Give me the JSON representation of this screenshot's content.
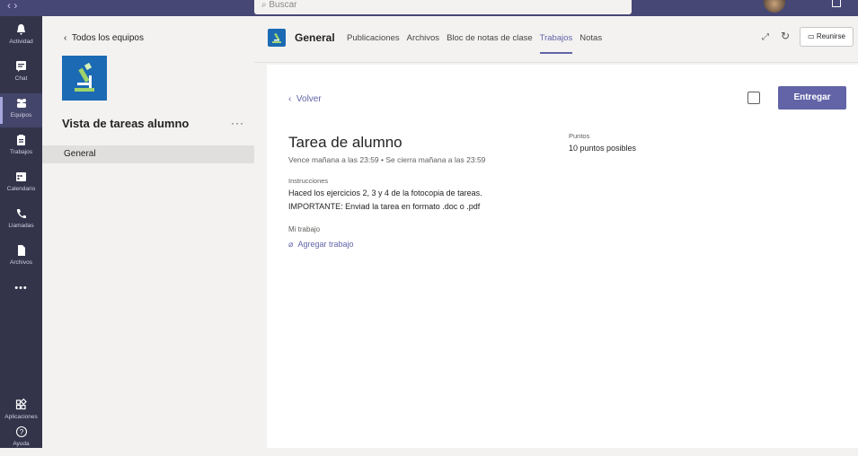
{
  "topbar": {
    "search_placeholder": "Buscar",
    "nav_arrows": "‹  ›"
  },
  "rail": {
    "items": [
      {
        "label": "Actividad",
        "icon": "bell-icon",
        "glyph": "🔔"
      },
      {
        "label": "Chat",
        "icon": "chat-icon",
        "glyph": "▤"
      },
      {
        "label": "Equipos",
        "icon": "teams-icon",
        "glyph": "⁂"
      },
      {
        "label": "Trabajos",
        "icon": "assignments-icon",
        "glyph": "▣"
      },
      {
        "label": "Calendario",
        "icon": "calendar-icon",
        "glyph": "▦"
      },
      {
        "label": "Llamadas",
        "icon": "phone-icon",
        "glyph": "✆"
      },
      {
        "label": "Archivos",
        "icon": "files-icon",
        "glyph": "▮"
      },
      {
        "label": "",
        "icon": "more-icon",
        "glyph": "•••"
      },
      {
        "label": "Aplicaciones",
        "icon": "apps-icon",
        "glyph": "⊞"
      },
      {
        "label": "Ayuda",
        "icon": "help-icon",
        "glyph": "?"
      }
    ]
  },
  "left_panel": {
    "back_label": "Todos los equipos",
    "team_title": "Vista de tareas alumno",
    "more": "···",
    "channel": "General"
  },
  "header": {
    "channel_name": "General",
    "tabs": [
      {
        "label": "Publicaciones",
        "active": false
      },
      {
        "label": "Archivos",
        "active": false
      },
      {
        "label": "Bloc de notas de clase",
        "active": false
      },
      {
        "label": "Trabajos",
        "active": true
      },
      {
        "label": "Notas",
        "active": false
      }
    ],
    "meet_label": "Reunirse"
  },
  "assignment": {
    "back_label": "Volver",
    "submit_label": "Entregar",
    "title": "Tarea de alumno",
    "due": "Vence mañana a las 23:59  •  Se cierra mañana a las 23:59",
    "points_label": "Puntos",
    "points_value": "10 puntos posibles",
    "instructions_label": "Instrucciones",
    "instructions_line1": "Haced los ejercicios 2, 3 y 4 de la fotocopia de tareas.",
    "instructions_line2": "IMPORTANTE: Enviad la tarea en formato .doc o .pdf",
    "my_work_label": "Mi trabajo",
    "add_work_label": "Agregar trabajo"
  },
  "colors": {
    "accent": "#6264a7",
    "rail_bg": "#33344a",
    "topbar_bg": "#464775",
    "team_blue": "#1b6ab3"
  }
}
